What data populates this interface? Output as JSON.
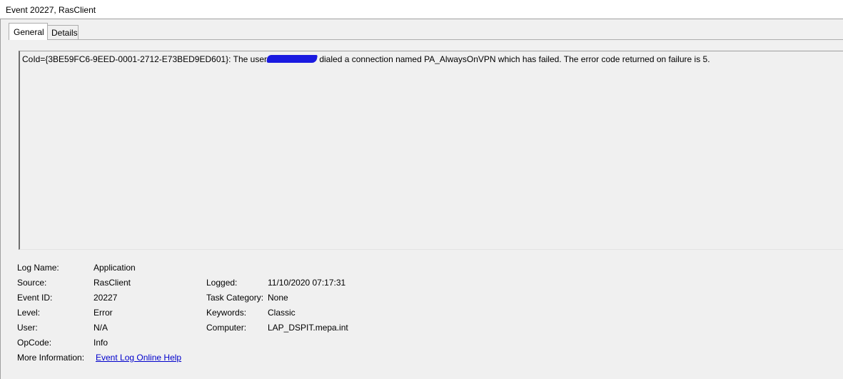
{
  "window": {
    "title": "Event 20227, RasClient"
  },
  "tabs": [
    {
      "label": "General",
      "selected": true
    },
    {
      "label": "Details",
      "selected": false
    }
  ],
  "description": {
    "before_redaction": "CoId={3BE59FC6-9EED-0001-2712-E73BED9ED601}: The user",
    "after_redaction": " dialed a connection named PA_AlwaysOnVPN which has failed. The error code returned on failure is 5.",
    "redaction_color": "#1a1ae0"
  },
  "fields": {
    "log_name": {
      "label": "Log Name:",
      "value": "Application"
    },
    "source": {
      "label": "Source:",
      "value": "RasClient"
    },
    "logged": {
      "label": "Logged:",
      "value": "11/10/2020 07:17:31"
    },
    "event_id": {
      "label": "Event ID:",
      "value": "20227"
    },
    "task_category": {
      "label": "Task Category:",
      "value": "None"
    },
    "level": {
      "label": "Level:",
      "value": "Error"
    },
    "keywords": {
      "label": "Keywords:",
      "value": "Classic"
    },
    "user": {
      "label": "User:",
      "value": "N/A"
    },
    "computer": {
      "label": "Computer:",
      "value": "LAP_DSPIT.mepa.int"
    },
    "opcode": {
      "label": "OpCode:",
      "value": "Info"
    },
    "more_information": {
      "label": "More Information:",
      "link_text": "Event Log Online Help"
    }
  },
  "colors": {
    "link": "#0000cc",
    "background": "#f0f0f0"
  }
}
